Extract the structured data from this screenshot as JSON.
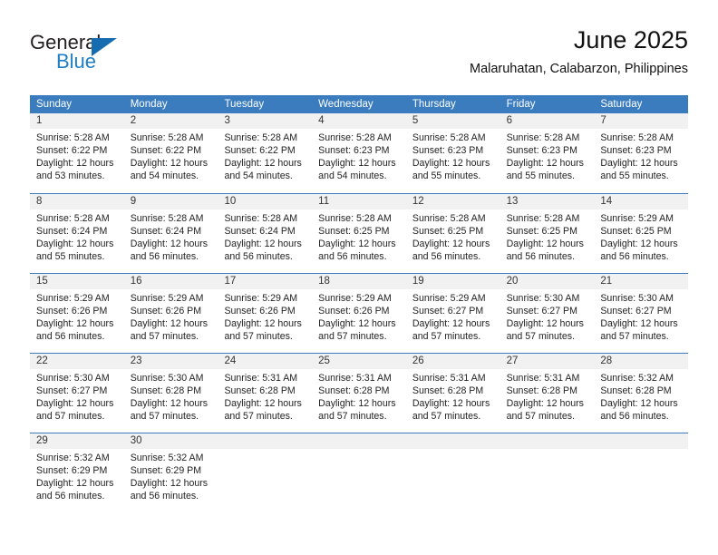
{
  "logo": {
    "word_one": "General",
    "word_two": "Blue",
    "triangle_icon": "blue-triangle-icon",
    "accent_dark": "#231f20",
    "accent_blue": "#1f7fc4"
  },
  "header": {
    "title": "June 2025",
    "subtitle": "Malaruhatan, Calabarzon, Philippines"
  },
  "theme": {
    "header_bar": "#3a7cbe",
    "day_number_bg": "#f1f1f1",
    "text": "#232323"
  },
  "weekdays": [
    "Sunday",
    "Monday",
    "Tuesday",
    "Wednesday",
    "Thursday",
    "Friday",
    "Saturday"
  ],
  "weeks": [
    [
      {
        "day": "1",
        "sunrise": "Sunrise: 5:28 AM",
        "sunset": "Sunset: 6:22 PM",
        "daylight_1": "Daylight: 12 hours",
        "daylight_2": "and 53 minutes."
      },
      {
        "day": "2",
        "sunrise": "Sunrise: 5:28 AM",
        "sunset": "Sunset: 6:22 PM",
        "daylight_1": "Daylight: 12 hours",
        "daylight_2": "and 54 minutes."
      },
      {
        "day": "3",
        "sunrise": "Sunrise: 5:28 AM",
        "sunset": "Sunset: 6:22 PM",
        "daylight_1": "Daylight: 12 hours",
        "daylight_2": "and 54 minutes."
      },
      {
        "day": "4",
        "sunrise": "Sunrise: 5:28 AM",
        "sunset": "Sunset: 6:23 PM",
        "daylight_1": "Daylight: 12 hours",
        "daylight_2": "and 54 minutes."
      },
      {
        "day": "5",
        "sunrise": "Sunrise: 5:28 AM",
        "sunset": "Sunset: 6:23 PM",
        "daylight_1": "Daylight: 12 hours",
        "daylight_2": "and 55 minutes."
      },
      {
        "day": "6",
        "sunrise": "Sunrise: 5:28 AM",
        "sunset": "Sunset: 6:23 PM",
        "daylight_1": "Daylight: 12 hours",
        "daylight_2": "and 55 minutes."
      },
      {
        "day": "7",
        "sunrise": "Sunrise: 5:28 AM",
        "sunset": "Sunset: 6:23 PM",
        "daylight_1": "Daylight: 12 hours",
        "daylight_2": "and 55 minutes."
      }
    ],
    [
      {
        "day": "8",
        "sunrise": "Sunrise: 5:28 AM",
        "sunset": "Sunset: 6:24 PM",
        "daylight_1": "Daylight: 12 hours",
        "daylight_2": "and 55 minutes."
      },
      {
        "day": "9",
        "sunrise": "Sunrise: 5:28 AM",
        "sunset": "Sunset: 6:24 PM",
        "daylight_1": "Daylight: 12 hours",
        "daylight_2": "and 56 minutes."
      },
      {
        "day": "10",
        "sunrise": "Sunrise: 5:28 AM",
        "sunset": "Sunset: 6:24 PM",
        "daylight_1": "Daylight: 12 hours",
        "daylight_2": "and 56 minutes."
      },
      {
        "day": "11",
        "sunrise": "Sunrise: 5:28 AM",
        "sunset": "Sunset: 6:25 PM",
        "daylight_1": "Daylight: 12 hours",
        "daylight_2": "and 56 minutes."
      },
      {
        "day": "12",
        "sunrise": "Sunrise: 5:28 AM",
        "sunset": "Sunset: 6:25 PM",
        "daylight_1": "Daylight: 12 hours",
        "daylight_2": "and 56 minutes."
      },
      {
        "day": "13",
        "sunrise": "Sunrise: 5:28 AM",
        "sunset": "Sunset: 6:25 PM",
        "daylight_1": "Daylight: 12 hours",
        "daylight_2": "and 56 minutes."
      },
      {
        "day": "14",
        "sunrise": "Sunrise: 5:29 AM",
        "sunset": "Sunset: 6:25 PM",
        "daylight_1": "Daylight: 12 hours",
        "daylight_2": "and 56 minutes."
      }
    ],
    [
      {
        "day": "15",
        "sunrise": "Sunrise: 5:29 AM",
        "sunset": "Sunset: 6:26 PM",
        "daylight_1": "Daylight: 12 hours",
        "daylight_2": "and 56 minutes."
      },
      {
        "day": "16",
        "sunrise": "Sunrise: 5:29 AM",
        "sunset": "Sunset: 6:26 PM",
        "daylight_1": "Daylight: 12 hours",
        "daylight_2": "and 57 minutes."
      },
      {
        "day": "17",
        "sunrise": "Sunrise: 5:29 AM",
        "sunset": "Sunset: 6:26 PM",
        "daylight_1": "Daylight: 12 hours",
        "daylight_2": "and 57 minutes."
      },
      {
        "day": "18",
        "sunrise": "Sunrise: 5:29 AM",
        "sunset": "Sunset: 6:26 PM",
        "daylight_1": "Daylight: 12 hours",
        "daylight_2": "and 57 minutes."
      },
      {
        "day": "19",
        "sunrise": "Sunrise: 5:29 AM",
        "sunset": "Sunset: 6:27 PM",
        "daylight_1": "Daylight: 12 hours",
        "daylight_2": "and 57 minutes."
      },
      {
        "day": "20",
        "sunrise": "Sunrise: 5:30 AM",
        "sunset": "Sunset: 6:27 PM",
        "daylight_1": "Daylight: 12 hours",
        "daylight_2": "and 57 minutes."
      },
      {
        "day": "21",
        "sunrise": "Sunrise: 5:30 AM",
        "sunset": "Sunset: 6:27 PM",
        "daylight_1": "Daylight: 12 hours",
        "daylight_2": "and 57 minutes."
      }
    ],
    [
      {
        "day": "22",
        "sunrise": "Sunrise: 5:30 AM",
        "sunset": "Sunset: 6:27 PM",
        "daylight_1": "Daylight: 12 hours",
        "daylight_2": "and 57 minutes."
      },
      {
        "day": "23",
        "sunrise": "Sunrise: 5:30 AM",
        "sunset": "Sunset: 6:28 PM",
        "daylight_1": "Daylight: 12 hours",
        "daylight_2": "and 57 minutes."
      },
      {
        "day": "24",
        "sunrise": "Sunrise: 5:31 AM",
        "sunset": "Sunset: 6:28 PM",
        "daylight_1": "Daylight: 12 hours",
        "daylight_2": "and 57 minutes."
      },
      {
        "day": "25",
        "sunrise": "Sunrise: 5:31 AM",
        "sunset": "Sunset: 6:28 PM",
        "daylight_1": "Daylight: 12 hours",
        "daylight_2": "and 57 minutes."
      },
      {
        "day": "26",
        "sunrise": "Sunrise: 5:31 AM",
        "sunset": "Sunset: 6:28 PM",
        "daylight_1": "Daylight: 12 hours",
        "daylight_2": "and 57 minutes."
      },
      {
        "day": "27",
        "sunrise": "Sunrise: 5:31 AM",
        "sunset": "Sunset: 6:28 PM",
        "daylight_1": "Daylight: 12 hours",
        "daylight_2": "and 57 minutes."
      },
      {
        "day": "28",
        "sunrise": "Sunrise: 5:32 AM",
        "sunset": "Sunset: 6:28 PM",
        "daylight_1": "Daylight: 12 hours",
        "daylight_2": "and 56 minutes."
      }
    ],
    [
      {
        "day": "29",
        "sunrise": "Sunrise: 5:32 AM",
        "sunset": "Sunset: 6:29 PM",
        "daylight_1": "Daylight: 12 hours",
        "daylight_2": "and 56 minutes."
      },
      {
        "day": "30",
        "sunrise": "Sunrise: 5:32 AM",
        "sunset": "Sunset: 6:29 PM",
        "daylight_1": "Daylight: 12 hours",
        "daylight_2": "and 56 minutes."
      },
      {
        "day": "",
        "sunrise": "",
        "sunset": "",
        "daylight_1": "",
        "daylight_2": ""
      },
      {
        "day": "",
        "sunrise": "",
        "sunset": "",
        "daylight_1": "",
        "daylight_2": ""
      },
      {
        "day": "",
        "sunrise": "",
        "sunset": "",
        "daylight_1": "",
        "daylight_2": ""
      },
      {
        "day": "",
        "sunrise": "",
        "sunset": "",
        "daylight_1": "",
        "daylight_2": ""
      },
      {
        "day": "",
        "sunrise": "",
        "sunset": "",
        "daylight_1": "",
        "daylight_2": ""
      }
    ]
  ]
}
